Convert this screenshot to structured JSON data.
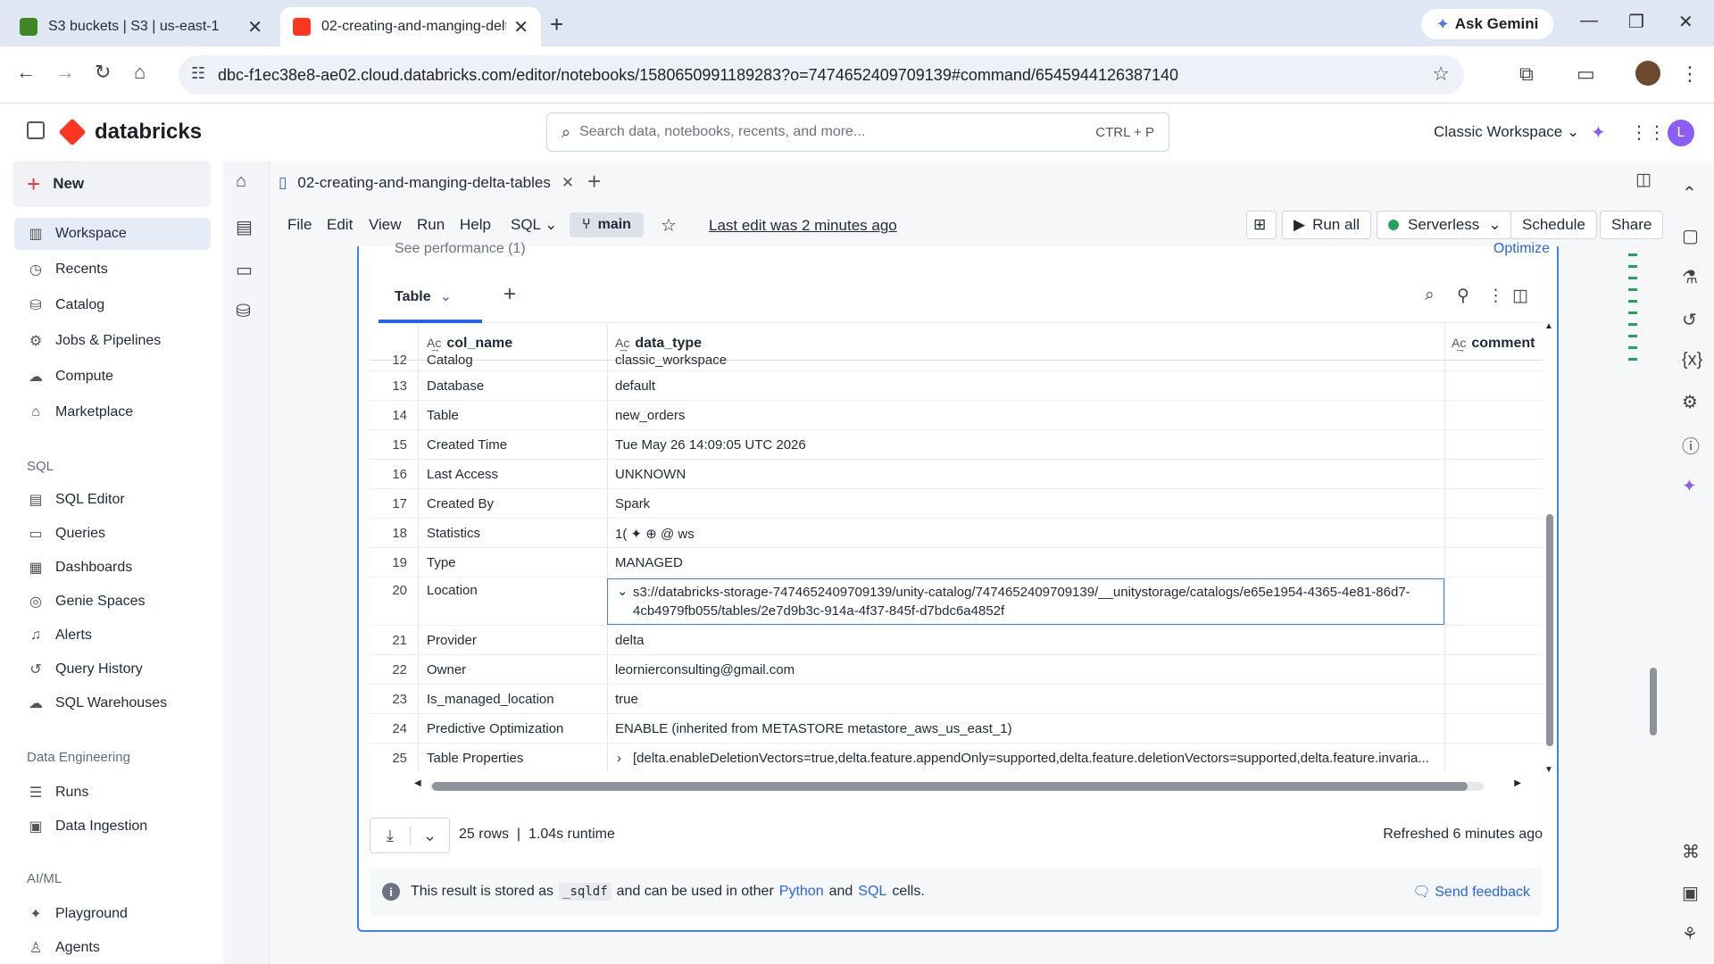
{
  "browser": {
    "tabs": [
      {
        "title": "S3 buckets | S3 | us-east-1",
        "active": false,
        "favicon_color": "#3f8624"
      },
      {
        "title": "02-creating-and-manging-delt",
        "active": true,
        "favicon_color": "#ff3621"
      }
    ],
    "ask_gemini": "Ask Gemini",
    "url": "dbc-f1ec38e8-ae02.cloud.databricks.com/editor/notebooks/1580650991189283?o=7474652409709139#command/6545944126387140"
  },
  "app": {
    "logo_text": "databricks",
    "search_placeholder": "Search data, notebooks, recents, and more...",
    "search_shortcut": "CTRL + P",
    "workspace": "Classic Workspace",
    "user_initial": "L"
  },
  "sidebar": {
    "new_label": "New",
    "main_items": [
      {
        "label": "Workspace",
        "icon": "folder-icon",
        "glyph": "▥"
      },
      {
        "label": "Recents",
        "icon": "clock-icon",
        "glyph": "◷"
      },
      {
        "label": "Catalog",
        "icon": "catalog-icon",
        "glyph": "⛁"
      },
      {
        "label": "Jobs & Pipelines",
        "icon": "jobs-icon",
        "glyph": "⚙"
      },
      {
        "label": "Compute",
        "icon": "cloud-icon",
        "glyph": "☁"
      },
      {
        "label": "Marketplace",
        "icon": "store-icon",
        "glyph": "⌂"
      }
    ],
    "sql_heading": "SQL",
    "sql_items": [
      {
        "label": "SQL Editor",
        "icon": "editor-icon",
        "glyph": "▤"
      },
      {
        "label": "Queries",
        "icon": "query-icon",
        "glyph": "▭"
      },
      {
        "label": "Dashboards",
        "icon": "dashboard-icon",
        "glyph": "▦"
      },
      {
        "label": "Genie Spaces",
        "icon": "genie-icon",
        "glyph": "◎"
      },
      {
        "label": "Alerts",
        "icon": "bell-icon",
        "glyph": "♫"
      },
      {
        "label": "Query History",
        "icon": "history-icon",
        "glyph": "↺"
      },
      {
        "label": "SQL Warehouses",
        "icon": "warehouse-icon",
        "glyph": "☁"
      }
    ],
    "de_heading": "Data Engineering",
    "de_items": [
      {
        "label": "Runs",
        "icon": "runs-icon",
        "glyph": "☰"
      },
      {
        "label": "Data Ingestion",
        "icon": "ingestion-icon",
        "glyph": "▣"
      }
    ],
    "ai_heading": "AI/ML",
    "ai_items": [
      {
        "label": "Playground",
        "icon": "playground-icon",
        "glyph": "✦"
      },
      {
        "label": "Agents",
        "icon": "agents-icon",
        "glyph": "♙"
      }
    ]
  },
  "notebook": {
    "tab_title": "02-creating-and-manging-delta-tables",
    "menus": [
      "File",
      "Edit",
      "View",
      "Run",
      "Help"
    ],
    "language": "SQL",
    "branch": "main",
    "last_edit": "Last edit was 2 minutes ago",
    "run_all": "Run all",
    "compute": "Serverless",
    "schedule": "Schedule",
    "share": "Share"
  },
  "cell": {
    "perf_link": "See performance (1)",
    "optimize": "Optimize",
    "result_tab": "Table",
    "columns": [
      "col_name",
      "data_type",
      "comment"
    ],
    "rows": [
      {
        "n": "12",
        "col": "Catalog",
        "val": "classic_workspace"
      },
      {
        "n": "13",
        "col": "Database",
        "val": "default"
      },
      {
        "n": "14",
        "col": "Table",
        "val": "new_orders"
      },
      {
        "n": "15",
        "col": "Created Time",
        "val": "Tue May 26 14:09:05 UTC 2026"
      },
      {
        "n": "16",
        "col": "Last Access",
        "val": "UNKNOWN"
      },
      {
        "n": "17",
        "col": "Created By",
        "val": "Spark"
      },
      {
        "n": "18",
        "col": "Statistics",
        "val": "1( ✦ ⊕ @ ws"
      },
      {
        "n": "19",
        "col": "Type",
        "val": "MANAGED"
      },
      {
        "n": "20",
        "col": "Location",
        "val": "s3://databricks-storage-7474652409709139/unity-catalog/7474652409709139/__unitystorage/catalogs/e65e1954-4365-4e81-86d7-4cb4979fb055/tables/2e7d9b3c-914a-4f37-845f-d7bdc6a4852f"
      },
      {
        "n": "21",
        "col": "Provider",
        "val": "delta"
      },
      {
        "n": "22",
        "col": "Owner",
        "val": "leornierconsulting@gmail.com"
      },
      {
        "n": "23",
        "col": "Is_managed_location",
        "val": "true"
      },
      {
        "n": "24",
        "col": "Predictive Optimization",
        "val": "ENABLE (inherited from METASTORE metastore_aws_us_east_1)"
      },
      {
        "n": "25",
        "col": "Table Properties",
        "val": "[delta.enableDeletionVectors=true,delta.feature.appendOnly=supported,delta.feature.deletionVectors=supported,delta.feature.invaria..."
      }
    ],
    "rows_count": "25 rows",
    "runtime": "1.04s runtime",
    "refreshed": "Refreshed 6 minutes ago",
    "info_prefix": "This result is stored as",
    "info_var": "_sqldf",
    "info_mid": "and can be used in other",
    "info_python": "Python",
    "info_and": "and",
    "info_sql": "SQL",
    "info_suffix": "cells.",
    "feedback": "Send feedback"
  }
}
